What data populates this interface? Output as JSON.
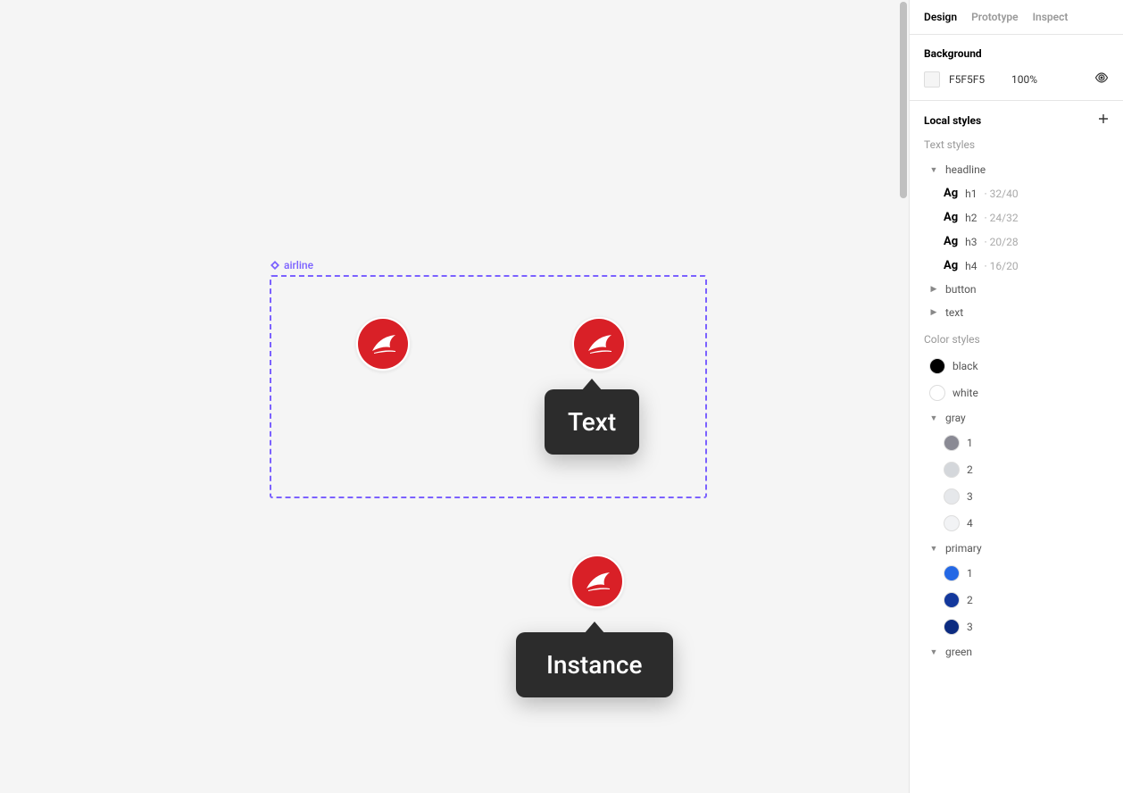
{
  "canvas": {
    "component_label": "airline",
    "tooltip_text": "Text",
    "tooltip_instance": "Instance"
  },
  "sidebar": {
    "tabs": [
      "Design",
      "Prototype",
      "Inspect"
    ],
    "active_tab": 0,
    "background": {
      "title": "Background",
      "hex": "F5F5F5",
      "opacity": "100%",
      "swatch": "#F5F5F5"
    },
    "local_styles_title": "Local styles",
    "text_styles": {
      "title": "Text styles",
      "groups": [
        {
          "name": "headline",
          "expanded": true,
          "items": [
            {
              "tag": "Ag",
              "name": "h1",
              "meta": "32/40"
            },
            {
              "tag": "Ag",
              "name": "h2",
              "meta": "24/32"
            },
            {
              "tag": "Ag",
              "name": "h3",
              "meta": "20/28"
            },
            {
              "tag": "Ag",
              "name": "h4",
              "meta": "16/20"
            }
          ]
        },
        {
          "name": "button",
          "expanded": false,
          "items": []
        },
        {
          "name": "text",
          "expanded": false,
          "items": []
        }
      ]
    },
    "color_styles": {
      "title": "Color styles",
      "items": [
        {
          "name": "black",
          "color": "#000000",
          "type": "single"
        },
        {
          "name": "white",
          "color": "#FFFFFF",
          "type": "single"
        },
        {
          "name": "gray",
          "type": "group",
          "expanded": true,
          "children": [
            {
              "name": "1",
              "color": "#8A8A94"
            },
            {
              "name": "2",
              "color": "#D4D7DB"
            },
            {
              "name": "3",
              "color": "#E6E8EB"
            },
            {
              "name": "4",
              "color": "#F2F3F5"
            }
          ]
        },
        {
          "name": "primary",
          "type": "group",
          "expanded": true,
          "children": [
            {
              "name": "1",
              "color": "#2468E5"
            },
            {
              "name": "2",
              "color": "#13389C"
            },
            {
              "name": "3",
              "color": "#0B2B80"
            }
          ]
        },
        {
          "name": "green",
          "type": "group",
          "expanded": true,
          "children": []
        }
      ]
    }
  }
}
